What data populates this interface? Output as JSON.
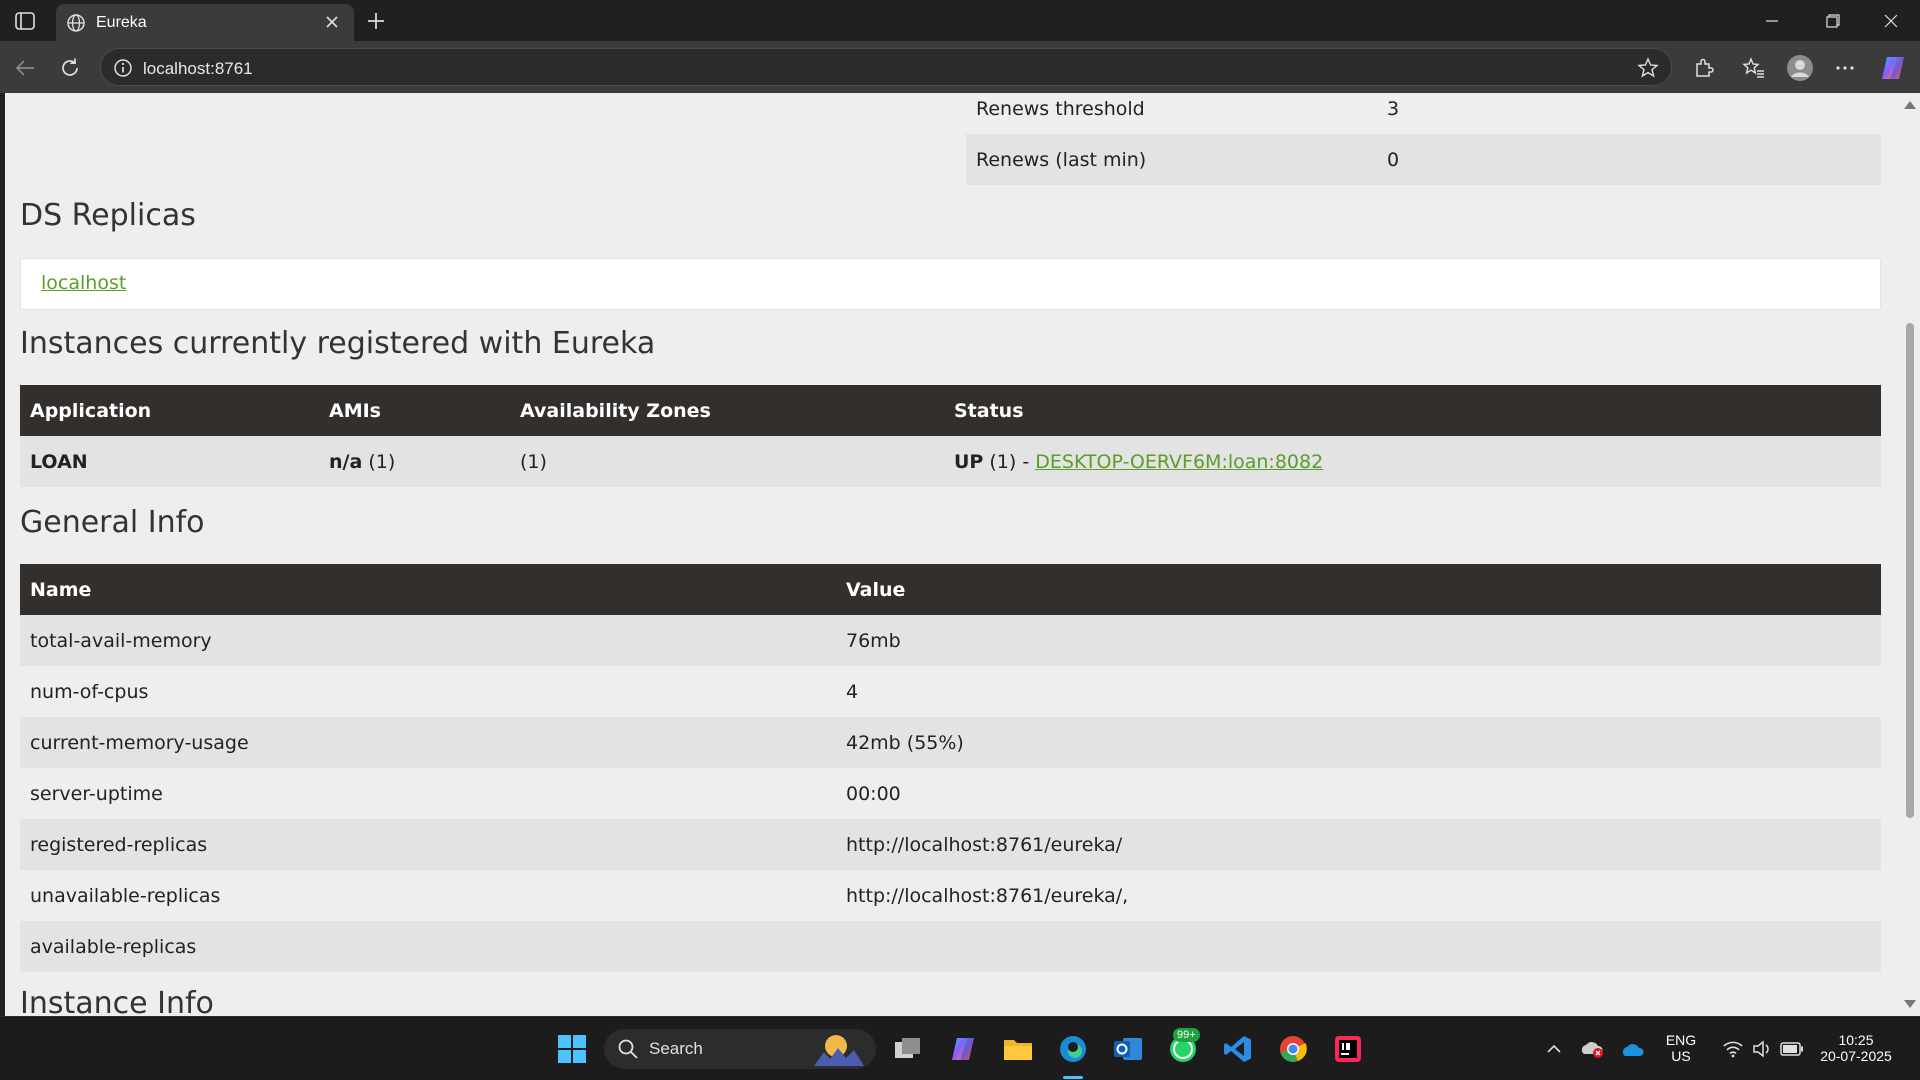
{
  "browser": {
    "tab_title": "Eureka",
    "url": "localhost:8761"
  },
  "renews": [
    {
      "label": "Renews threshold",
      "value": "3"
    },
    {
      "label": "Renews (last min)",
      "value": "0"
    }
  ],
  "ds_replicas": {
    "heading": "DS Replicas",
    "link": "localhost"
  },
  "instances": {
    "heading": "Instances currently registered with Eureka",
    "headers": [
      "Application",
      "AMIs",
      "Availability Zones",
      "Status"
    ],
    "row": {
      "application": "LOAN",
      "amis_bold": "n/a",
      "amis_count": " (1)",
      "zones": "(1)",
      "status_bold": "UP",
      "status_count": " (1) - ",
      "status_link": "DESKTOP-OERVF6M:loan:8082"
    }
  },
  "general_info": {
    "heading": "General Info",
    "headers": [
      "Name",
      "Value"
    ],
    "rows": [
      {
        "name": "total-avail-memory",
        "value": "76mb"
      },
      {
        "name": "num-of-cpus",
        "value": "4"
      },
      {
        "name": "current-memory-usage",
        "value": "42mb (55%)"
      },
      {
        "name": "server-uptime",
        "value": "00:00"
      },
      {
        "name": "registered-replicas",
        "value": "http://localhost:8761/eureka/"
      },
      {
        "name": "unavailable-replicas",
        "value": "http://localhost:8761/eureka/,"
      },
      {
        "name": "available-replicas",
        "value": ""
      }
    ]
  },
  "instance_info": {
    "heading": "Instance Info"
  },
  "taskbar": {
    "search_label": "Search",
    "whatsapp_badge": "99+",
    "lang_top": "ENG",
    "lang_bottom": "US",
    "time": "10:25",
    "date": "20-07-2025"
  },
  "colors": {
    "link_green": "#5a9e2a",
    "table_header": "#322f2d",
    "page_bg": "#eeeeee",
    "row_alt": "#e3e3e3"
  }
}
